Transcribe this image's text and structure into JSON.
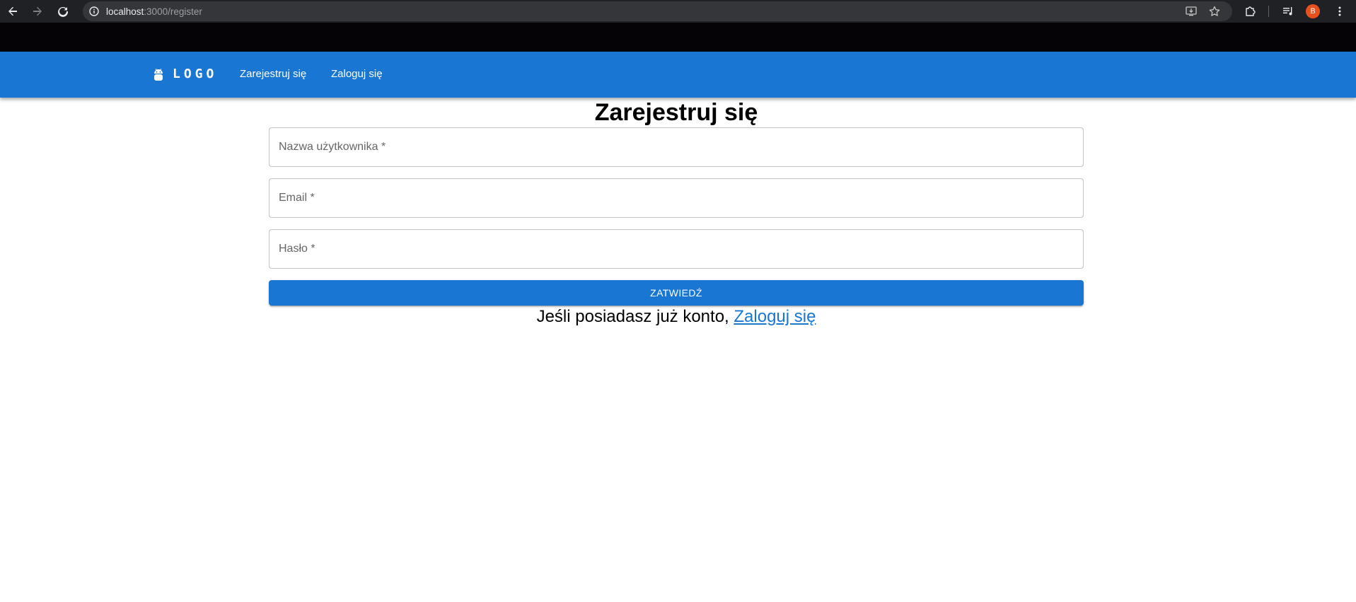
{
  "browser": {
    "url_host": "localhost",
    "url_path": ":3000/register",
    "profile_initial": "B"
  },
  "app_bar": {
    "logo_text": "LOGO",
    "links": [
      {
        "label": "Zarejestruj się"
      },
      {
        "label": "Zaloguj się"
      }
    ],
    "color": "#1976d2"
  },
  "form": {
    "title": "Zarejestruj się",
    "fields": [
      {
        "label": "Nazwa użytkownika *"
      },
      {
        "label": "Email *"
      },
      {
        "label": "Hasło *"
      }
    ],
    "submit_label": "ZATWIEDŹ",
    "login_prompt": "Jeśli posiadasz już konto, ",
    "login_link": "Zaloguj się"
  },
  "icons": {
    "back": "arrow-left-icon",
    "forward": "arrow-right-icon",
    "reload": "reload-icon",
    "site_info": "info-icon",
    "install": "install-app-icon",
    "bookmark": "star-icon",
    "extensions": "puzzle-icon",
    "media": "media-queue-icon",
    "menu": "kebab-menu-icon",
    "logo": "android-icon"
  }
}
